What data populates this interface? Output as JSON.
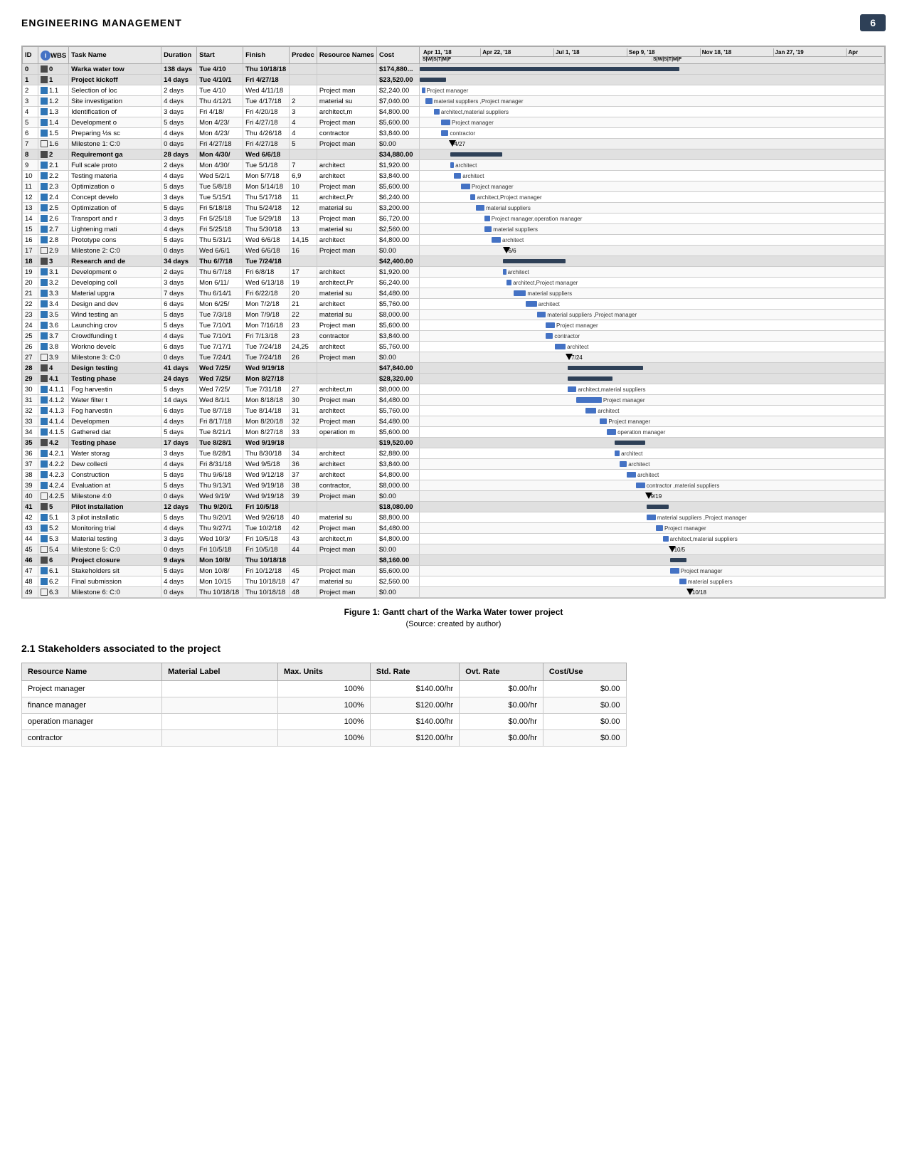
{
  "header": {
    "title": "ENGINEERING MANAGEMENT",
    "page_number": "6"
  },
  "gantt": {
    "columns": [
      "ID",
      "WBS",
      "Task Name",
      "Duration",
      "Start",
      "Finish",
      "Predec",
      "Resource Names",
      "Cost"
    ],
    "date_headers": [
      "Apr 11, '18",
      "Apr 22, '18",
      "Jul 1, '18",
      "Sep 9, '18",
      "Nov 18, '18",
      "Jan 27, '19",
      "Apr"
    ],
    "date_sub_headers": [
      "S|W|S|T|M|F",
      "S|W|S|T|M|F"
    ],
    "rows": [
      {
        "id": "0",
        "wbs": "0",
        "name": "Warka water tow",
        "duration": "138 days",
        "start": "Tue 4/10",
        "finish": "Thu 10/18/18",
        "predec": "",
        "resource": "",
        "cost": "$174,880...",
        "type": "summary"
      },
      {
        "id": "1",
        "wbs": "1",
        "name": "Project kickoff",
        "duration": "14 days",
        "start": "Tue 4/10/1",
        "finish": "Fri 4/27/18",
        "predec": "",
        "resource": "",
        "cost": "$23,520.00",
        "type": "summary"
      },
      {
        "id": "2",
        "wbs": "1.1",
        "name": "Selection of loc",
        "duration": "2 days",
        "start": "Tue 4/10",
        "finish": "Wed 4/11/18",
        "predec": "",
        "resource": "Project man",
        "cost": "$2,240.00",
        "type": "normal"
      },
      {
        "id": "3",
        "wbs": "1.2",
        "name": "Site investigation",
        "duration": "4 days",
        "start": "Thu 4/12/1",
        "finish": "Tue 4/17/18",
        "predec": "2",
        "resource": "material su",
        "cost": "$7,040.00",
        "type": "normal"
      },
      {
        "id": "4",
        "wbs": "1.3",
        "name": "Identification of",
        "duration": "3 days",
        "start": "Fri 4/18/",
        "finish": "Fri 4/20/18",
        "predec": "3",
        "resource": "architect,m",
        "cost": "$4,800.00",
        "type": "normal"
      },
      {
        "id": "5",
        "wbs": "1.4",
        "name": "Development o",
        "duration": "5 days",
        "start": "Mon 4/23/",
        "finish": "Fri 4/27/18",
        "predec": "4",
        "resource": "Project man",
        "cost": "$5,600.00",
        "type": "normal"
      },
      {
        "id": "6",
        "wbs": "1.5",
        "name": "Preparing ½s sc",
        "duration": "4 days",
        "start": "Mon 4/23/",
        "finish": "Thu 4/26/18",
        "predec": "4",
        "resource": "contractor",
        "cost": "$3,840.00",
        "type": "normal"
      },
      {
        "id": "7",
        "wbs": "1.6",
        "name": "Milestone 1: C:0",
        "duration": "0 days",
        "start": "Fri 4/27/18",
        "finish": "Fri 4/27/18",
        "predec": "5",
        "resource": "Project man",
        "cost": "$0.00",
        "type": "milestone"
      },
      {
        "id": "8",
        "wbs": "2",
        "name": "Requiremont ga",
        "duration": "28 days",
        "start": "Mon 4/30/",
        "finish": "Wed 6/6/18",
        "predec": "",
        "resource": "",
        "cost": "$34,880.00",
        "type": "summary"
      },
      {
        "id": "9",
        "wbs": "2.1",
        "name": "Full scale proto",
        "duration": "2 days",
        "start": "Mon 4/30/",
        "finish": "Tue 5/1/18",
        "predec": "7",
        "resource": "architect",
        "cost": "$1,920.00",
        "type": "normal"
      },
      {
        "id": "10",
        "wbs": "2.2",
        "name": "Testing materia",
        "duration": "4 days",
        "start": "Wed 5/2/1",
        "finish": "Mon 5/7/18",
        "predec": "6,9",
        "resource": "architect",
        "cost": "$3,840.00",
        "type": "normal"
      },
      {
        "id": "11",
        "wbs": "2.3",
        "name": "Optimization o",
        "duration": "5 days",
        "start": "Tue 5/8/18",
        "finish": "Mon 5/14/18",
        "predec": "10",
        "resource": "Project man",
        "cost": "$5,600.00",
        "type": "normal"
      },
      {
        "id": "12",
        "wbs": "2.4",
        "name": "Concept develo",
        "duration": "3 days",
        "start": "Tue 5/15/1",
        "finish": "Thu 5/17/18",
        "predec": "11",
        "resource": "architect,Pr",
        "cost": "$6,240.00",
        "type": "normal"
      },
      {
        "id": "13",
        "wbs": "2.5",
        "name": "Optimization of",
        "duration": "5 days",
        "start": "Fri 5/18/18",
        "finish": "Thu 5/24/18",
        "predec": "12",
        "resource": "material su",
        "cost": "$3,200.00",
        "type": "normal"
      },
      {
        "id": "14",
        "wbs": "2.6",
        "name": "Transport and r",
        "duration": "3 days",
        "start": "Fri 5/25/18",
        "finish": "Tue 5/29/18",
        "predec": "13",
        "resource": "Project man",
        "cost": "$6,720.00",
        "type": "normal"
      },
      {
        "id": "15",
        "wbs": "2.7",
        "name": "Lightening mati",
        "duration": "4 days",
        "start": "Fri 5/25/18",
        "finish": "Thu 5/30/18",
        "predec": "13",
        "resource": "material su",
        "cost": "$2,560.00",
        "type": "normal"
      },
      {
        "id": "16",
        "wbs": "2.8",
        "name": "Prototype cons",
        "duration": "5 days",
        "start": "Thu 5/31/1",
        "finish": "Wed 6/6/18",
        "predec": "14,15",
        "resource": "architect",
        "cost": "$4,800.00",
        "type": "normal"
      },
      {
        "id": "17",
        "wbs": "2.9",
        "name": "Milestone 2: C:0",
        "duration": "0 days",
        "start": "Wed 6/6/1",
        "finish": "Wed 6/6/18",
        "predec": "16",
        "resource": "Project man",
        "cost": "$0.00",
        "type": "milestone"
      },
      {
        "id": "18",
        "wbs": "3",
        "name": "Research and de",
        "duration": "34 days",
        "start": "Thu 6/7/18",
        "finish": "Tue 7/24/18",
        "predec": "",
        "resource": "",
        "cost": "$42,400.00",
        "type": "summary"
      },
      {
        "id": "19",
        "wbs": "3.1",
        "name": "Development o",
        "duration": "2 days",
        "start": "Thu 6/7/18",
        "finish": "Fri 6/8/18",
        "predec": "17",
        "resource": "architect",
        "cost": "$1,920.00",
        "type": "normal"
      },
      {
        "id": "20",
        "wbs": "3.2",
        "name": "Developing coll",
        "duration": "3 days",
        "start": "Mon 6/11/",
        "finish": "Wed 6/13/18",
        "predec": "19",
        "resource": "architect,Pr",
        "cost": "$6,240.00",
        "type": "normal"
      },
      {
        "id": "21",
        "wbs": "3.3",
        "name": "Material upgra",
        "duration": "7 days",
        "start": "Thu 6/14/1",
        "finish": "Fri 6/22/18",
        "predec": "20",
        "resource": "material su",
        "cost": "$4,480.00",
        "type": "normal"
      },
      {
        "id": "22",
        "wbs": "3.4",
        "name": "Design and dev",
        "duration": "6 days",
        "start": "Mon 6/25/",
        "finish": "Mon 7/2/18",
        "predec": "21",
        "resource": "architect",
        "cost": "$5,760.00",
        "type": "normal"
      },
      {
        "id": "23",
        "wbs": "3.5",
        "name": "Wind testing an",
        "duration": "5 days",
        "start": "Tue 7/3/18",
        "finish": "Mon 7/9/18",
        "predec": "22",
        "resource": "material su",
        "cost": "$8,000.00",
        "type": "normal"
      },
      {
        "id": "24",
        "wbs": "3.6",
        "name": "Launching crov",
        "duration": "5 days",
        "start": "Tue 7/10/1",
        "finish": "Mon 7/16/18",
        "predec": "23",
        "resource": "Project man",
        "cost": "$5,600.00",
        "type": "normal"
      },
      {
        "id": "25",
        "wbs": "3.7",
        "name": "Crowdfunding t",
        "duration": "4 days",
        "start": "Tue 7/10/1",
        "finish": "Fri 7/13/18",
        "predec": "23",
        "resource": "contractor",
        "cost": "$3,840.00",
        "type": "normal"
      },
      {
        "id": "26",
        "wbs": "3.8",
        "name": "Workno develc",
        "duration": "6 days",
        "start": "Tue 7/17/1",
        "finish": "Tue 7/24/18",
        "predec": "24,25",
        "resource": "architect",
        "cost": "$5,760.00",
        "type": "normal"
      },
      {
        "id": "27",
        "wbs": "3.9",
        "name": "Milestone 3: C:0",
        "duration": "0 days",
        "start": "Tue 7/24/1",
        "finish": "Tue 7/24/18",
        "predec": "26",
        "resource": "Project man",
        "cost": "$0.00",
        "type": "milestone"
      },
      {
        "id": "28",
        "wbs": "4",
        "name": "Design testing",
        "duration": "41 days",
        "start": "Wed 7/25/",
        "finish": "Wed 9/19/18",
        "predec": "",
        "resource": "",
        "cost": "$47,840.00",
        "type": "summary"
      },
      {
        "id": "29",
        "wbs": "4.1",
        "name": "Testing phase",
        "duration": "24 days",
        "start": "Wed 7/25/",
        "finish": "Mon 8/27/18",
        "predec": "",
        "resource": "",
        "cost": "$28,320.00",
        "type": "summary"
      },
      {
        "id": "30",
        "wbs": "4.1.1",
        "name": "Fog harvestin",
        "duration": "5 days",
        "start": "Wed 7/25/",
        "finish": "Tue 7/31/18",
        "predec": "27",
        "resource": "architect,m",
        "cost": "$8,000.00",
        "type": "normal"
      },
      {
        "id": "31",
        "wbs": "4.1.2",
        "name": "Water filter t",
        "duration": "14 days",
        "start": "Wed 8/1/1",
        "finish": "Mon 8/18/18",
        "predec": "30",
        "resource": "Project man",
        "cost": "$4,480.00",
        "type": "normal"
      },
      {
        "id": "32",
        "wbs": "4.1.3",
        "name": "Fog harvestin",
        "duration": "6 days",
        "start": "Tue 8/7/18",
        "finish": "Tue 8/14/18",
        "predec": "31",
        "resource": "architect",
        "cost": "$5,760.00",
        "type": "normal"
      },
      {
        "id": "33",
        "wbs": "4.1.4",
        "name": "Developmen",
        "duration": "4 days",
        "start": "Fri 8/17/18",
        "finish": "Mon 8/20/18",
        "predec": "32",
        "resource": "Project man",
        "cost": "$4,480.00",
        "type": "normal"
      },
      {
        "id": "34",
        "wbs": "4.1.5",
        "name": "Gathered dat",
        "duration": "5 days",
        "start": "Tue 8/21/1",
        "finish": "Mon 8/27/18",
        "predec": "33",
        "resource": "operation m",
        "cost": "$5,600.00",
        "type": "normal"
      },
      {
        "id": "35",
        "wbs": "4.2",
        "name": "Testing phase",
        "duration": "17 days",
        "start": "Tue 8/28/1",
        "finish": "Wed 9/19/18",
        "predec": "",
        "resource": "",
        "cost": "$19,520.00",
        "type": "summary"
      },
      {
        "id": "36",
        "wbs": "4.2.1",
        "name": "Water storag",
        "duration": "3 days",
        "start": "Tue 8/28/1",
        "finish": "Thu 8/30/18",
        "predec": "34",
        "resource": "architect",
        "cost": "$2,880.00",
        "type": "normal"
      },
      {
        "id": "37",
        "wbs": "4.2.2",
        "name": "Dew collecti",
        "duration": "4 days",
        "start": "Fri 8/31/18",
        "finish": "Wed 9/5/18",
        "predec": "36",
        "resource": "architect",
        "cost": "$3,840.00",
        "type": "normal"
      },
      {
        "id": "38",
        "wbs": "4.2.3",
        "name": "Construction",
        "duration": "5 days",
        "start": "Thu 9/6/18",
        "finish": "Wed 9/12/18",
        "predec": "37",
        "resource": "architect",
        "cost": "$4,800.00",
        "type": "normal"
      },
      {
        "id": "39",
        "wbs": "4.2.4",
        "name": "Evaluation at",
        "duration": "5 days",
        "start": "Thu 9/13/1",
        "finish": "Wed 9/19/18",
        "predec": "38",
        "resource": "contractor,",
        "cost": "$8,000.00",
        "type": "normal"
      },
      {
        "id": "40",
        "wbs": "4.2.5",
        "name": "Milestone 4:0",
        "duration": "0 days",
        "start": "Wed 9/19/",
        "finish": "Wed 9/19/18",
        "predec": "39",
        "resource": "Project man",
        "cost": "$0.00",
        "type": "milestone"
      },
      {
        "id": "41",
        "wbs": "5",
        "name": "Pilot installation",
        "duration": "12 days",
        "start": "Thu 9/20/1",
        "finish": "Fri 10/5/18",
        "predec": "",
        "resource": "",
        "cost": "$18,080.00",
        "type": "summary"
      },
      {
        "id": "42",
        "wbs": "5.1",
        "name": "3 pilot installatic",
        "duration": "5 days",
        "start": "Thu 9/20/1",
        "finish": "Wed 9/26/18",
        "predec": "40",
        "resource": "material su",
        "cost": "$8,800.00",
        "type": "normal"
      },
      {
        "id": "43",
        "wbs": "5.2",
        "name": "Monitoring trial",
        "duration": "4 days",
        "start": "Thu 9/27/1",
        "finish": "Tue 10/2/18",
        "predec": "42",
        "resource": "Project man",
        "cost": "$4,480.00",
        "type": "normal"
      },
      {
        "id": "44",
        "wbs": "5.3",
        "name": "Material testing",
        "duration": "3 days",
        "start": "Wed 10/3/",
        "finish": "Fri 10/5/18",
        "predec": "43",
        "resource": "architect,m",
        "cost": "$4,800.00",
        "type": "normal"
      },
      {
        "id": "45",
        "wbs": "5.4",
        "name": "Milestone 5: C:0",
        "duration": "0 days",
        "start": "Fri 10/5/18",
        "finish": "Fri 10/5/18",
        "predec": "44",
        "resource": "Project man",
        "cost": "$0.00",
        "type": "milestone"
      },
      {
        "id": "46",
        "wbs": "6",
        "name": "Project closure",
        "duration": "9 days",
        "start": "Mon 10/8/",
        "finish": "Thu 10/18/18",
        "predec": "",
        "resource": "",
        "cost": "$8,160.00",
        "type": "summary"
      },
      {
        "id": "47",
        "wbs": "6.1",
        "name": "Stakeholders sit",
        "duration": "5 days",
        "start": "Mon 10/8/",
        "finish": "Fri 10/12/18",
        "predec": "45",
        "resource": "Project man",
        "cost": "$5,600.00",
        "type": "normal"
      },
      {
        "id": "48",
        "wbs": "6.2",
        "name": "Final submission",
        "duration": "4 days",
        "start": "Mon 10/15",
        "finish": "Thu 10/18/18",
        "predec": "47",
        "resource": "material su",
        "cost": "$2,560.00",
        "type": "normal"
      },
      {
        "id": "49",
        "wbs": "6.3",
        "name": "Milestone 6: C:0",
        "duration": "0 days",
        "start": "Thu 10/18/18",
        "finish": "Thu 10/18/18",
        "predec": "48",
        "resource": "Project man",
        "cost": "$0.00",
        "type": "milestone"
      }
    ]
  },
  "figure_caption": "Figure 1: Gantt chart of the Warka Water tower project",
  "figure_source": "(Source: created by author)",
  "section_title": "2.1 Stakeholders associated to the project",
  "resource_table": {
    "columns": [
      "Resource Name",
      "Material Label",
      "Max. Units",
      "Std. Rate",
      "Ovt. Rate",
      "Cost/Use"
    ],
    "rows": [
      {
        "name": "Project manager",
        "label": "",
        "max_units": "100%",
        "std_rate": "$140.00/hr",
        "ovt_rate": "$0.00/hr",
        "cost_use": "$0.00"
      },
      {
        "name": "finance manager",
        "label": "",
        "max_units": "100%",
        "std_rate": "$120.00/hr",
        "ovt_rate": "$0.00/hr",
        "cost_use": "$0.00"
      },
      {
        "name": "operation manager",
        "label": "",
        "max_units": "100%",
        "std_rate": "$140.00/hr",
        "ovt_rate": "$0.00/hr",
        "cost_use": "$0.00"
      },
      {
        "name": "contractor",
        "label": "",
        "max_units": "100%",
        "std_rate": "$120.00/hr",
        "ovt_rate": "$0.00/hr",
        "cost_use": "$0.00"
      }
    ]
  }
}
